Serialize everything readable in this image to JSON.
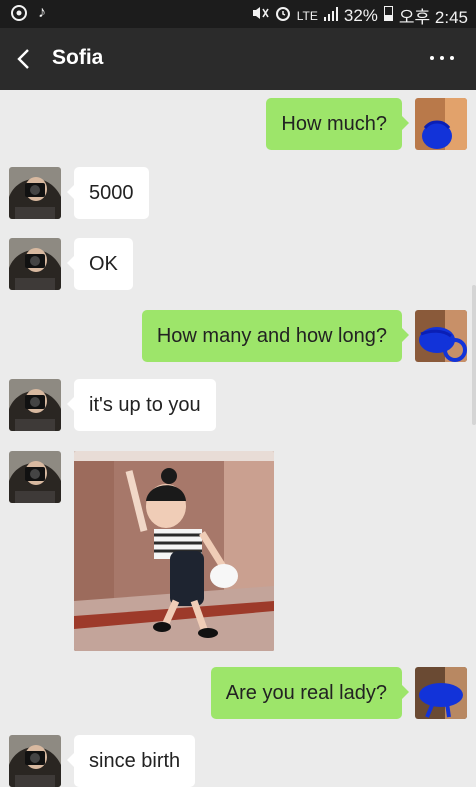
{
  "status_bar": {
    "network": "LTE",
    "battery": "32%",
    "time": "오후 2:45"
  },
  "header": {
    "title": "Sofia"
  },
  "colors": {
    "background": "#ebebeb",
    "header": "#2b2b2b",
    "sent_bubble": "#9de56a",
    "received_bubble": "#ffffff"
  },
  "messages": [
    {
      "from": "me",
      "text": "How much?"
    },
    {
      "from": "them",
      "text": "5000"
    },
    {
      "from": "them",
      "text": "OK"
    },
    {
      "from": "me",
      "text": "How many and how long?"
    },
    {
      "from": "them",
      "text": "it's  up to you"
    },
    {
      "from": "them",
      "type": "image"
    },
    {
      "from": "me",
      "text": "Are you real lady?"
    },
    {
      "from": "them",
      "text": "since birth"
    }
  ]
}
